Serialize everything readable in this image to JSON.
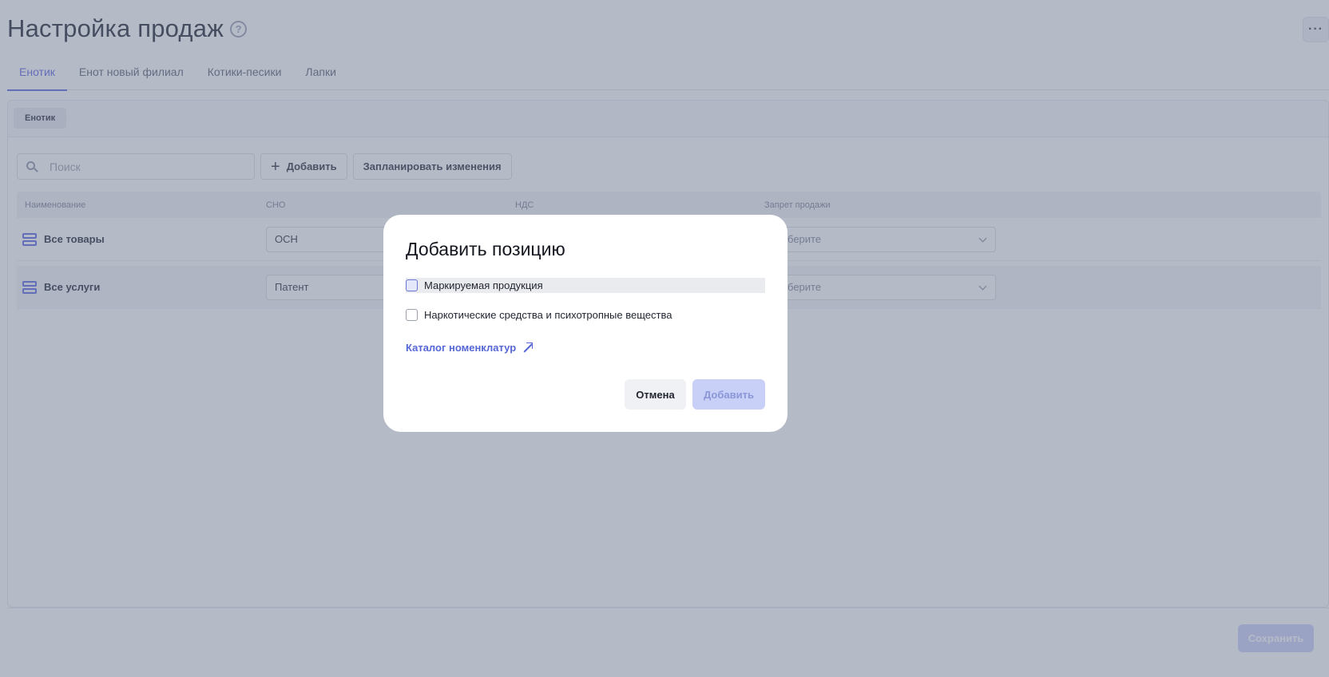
{
  "header": {
    "title": "Настройка продаж",
    "help_icon": "?",
    "more_icon": "···"
  },
  "tabs": [
    {
      "label": "Енотик",
      "active": true
    },
    {
      "label": "Енот новый филиал",
      "active": false
    },
    {
      "label": "Котики-песики",
      "active": false
    },
    {
      "label": "Лапки",
      "active": false
    }
  ],
  "chip": {
    "label": "Енотик"
  },
  "toolbar": {
    "search_placeholder": "Поиск",
    "add_icon": "+",
    "add_label": "Добавить",
    "schedule_label": "Запланировать изменения"
  },
  "table": {
    "columns": [
      "Наименование",
      "СНО",
      "НДС",
      "Запрет продажи"
    ],
    "rows": [
      {
        "name": "Все товары",
        "sno": "ОСН",
        "ban": "Выберите"
      },
      {
        "name": "Все услуги",
        "sno": "Патент",
        "ban": "Выберите"
      }
    ]
  },
  "footer": {
    "save_label": "Сохранить"
  },
  "modal": {
    "title": "Добавить позицию",
    "options": [
      {
        "label": "Маркируемая продукция",
        "checked": false
      },
      {
        "label": "Наркотические средства и психотропные вещества",
        "checked": false
      }
    ],
    "catalog_link": "Каталог номенклатур",
    "cancel_label": "Отмена",
    "add_label": "Добавить"
  },
  "colors": {
    "accent": "#5b66e0",
    "link": "#5566d6",
    "disabled_button": "#c8d0f8",
    "overlay": "#6b7590"
  }
}
